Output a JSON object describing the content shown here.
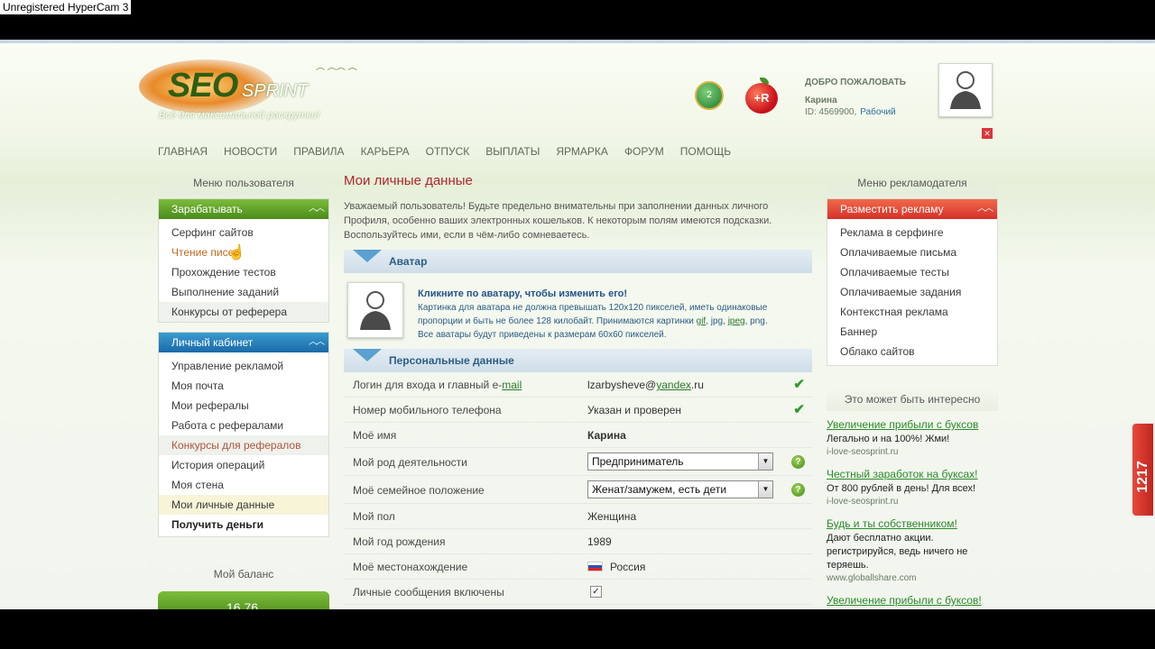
{
  "watermark": "Unregistered HyperCam 3",
  "logo": {
    "seo": "SEO",
    "sprint": "SPRINT",
    "tagline": "Всё для максимальной раскрутки!"
  },
  "header": {
    "medal_value": "2",
    "apple_label": "+R",
    "welcome": "ДОБРО ПОЖАЛОВАТЬ",
    "user_name": "Карина",
    "user_id": "ID: 4569900,",
    "user_status": "Рабочий"
  },
  "nav": [
    "ГЛАВНАЯ",
    "НОВОСТИ",
    "ПРАВИЛА",
    "КАРЬЕРА",
    "ОТПУСК",
    "ВЫПЛАТЫ",
    "ЯРМАРКА",
    "ФОРУМ",
    "ПОМОЩЬ"
  ],
  "left": {
    "title": "Меню пользователя",
    "earn": {
      "header": "Зарабатывать",
      "items": [
        "Серфинг сайтов",
        "Чтение писем",
        "Прохождение тестов",
        "Выполнение заданий",
        "Конкурсы от реферера"
      ]
    },
    "cabinet": {
      "header": "Личный кабинет",
      "items": [
        "Управление рекламой",
        "Моя почта",
        "Мои рефералы",
        "Работа с рефералами",
        "Конкурсы для рефералов",
        "История операций",
        "Моя стена",
        "Мои личные данные",
        "Получить деньги"
      ]
    },
    "balance_title": "Мой баланс",
    "balance_value": "16.76"
  },
  "main": {
    "title": "Мои личные данные",
    "intro": "Уважаемый пользователь! Будьте предельно внимательны при заполнении данных личного Профиля, особенно ваших электронных кошельков. К некоторым полям имеются подсказки. Воспользуйтесь ими, если в чём-либо сомневаетесь.",
    "avatar_section": "Аватар",
    "avatar_heading": "Кликните по аватару, чтобы изменить его!",
    "avatar_text_1": "Картинка для аватара не должна превышать 120х120 пикселей, иметь одинаковые пропорции и быть не более 128 килобайт. Принимаются картинки",
    "avatar_fmt_gif": "gif",
    "avatar_fmt_jpg": "jpg",
    "avatar_fmt_jpeg": "jpeg",
    "avatar_fmt_png": "png.",
    "avatar_text_2": "Все аватары будут приведены к размерам 60х60 пикселей.",
    "personal_section": "Персональные данные",
    "fields": {
      "login_label": "Логин для входа и главный e-",
      "login_label_link": "mail",
      "login_value_a": "lzarbysheve@",
      "login_value_link": "yandex",
      "login_value_b": ".ru",
      "phone_label": "Номер мобильного телефона",
      "phone_value": "Указан и проверен",
      "name_label": "Моё имя",
      "name_value": "Карина",
      "occupation_label": "Мой род деятельности",
      "occupation_value": "Предприниматель",
      "family_label": "Моё семейное положение",
      "family_value": "Женат/замужем, есть дети",
      "gender_label": "Мой пол",
      "gender_value": "Женщина",
      "birth_label": "Мой год рождения",
      "birth_value": "1989",
      "location_label": "Моё местонахождение",
      "location_value": "Россия",
      "messages_label": "Личные сообщения включены"
    }
  },
  "right": {
    "title": "Меню рекламодателя",
    "ads": {
      "header": "Разместить рекламу",
      "items": [
        "Реклама в серфинге",
        "Оплачиваемые письма",
        "Оплачиваемые тесты",
        "Оплачиваемые задания",
        "Контекстная реклама",
        "Баннер",
        "Облако сайтов"
      ]
    },
    "interest_title": "Это может быть интересно",
    "promos": [
      {
        "h": "Увеличение прибыли с буксов",
        "d": "Легально и на 100%! Жми!",
        "s": "i-love-seosprint.ru"
      },
      {
        "h": "Честный заработок на буксах!",
        "d": "От 800 рублей в день! Для всех!",
        "s": "i-love-seosprint.ru"
      },
      {
        "h": "Будь и ты собственником!",
        "d": "Дают бесплатно акции. регистрируйся, ведь ничего не теряешь.",
        "s": "www.globallshare.com"
      },
      {
        "h": "Увеличение прибыли с буксов!",
        "d": "",
        "s": ""
      }
    ]
  },
  "side_tab": "1217",
  "icons": {
    "check": "check-icon",
    "help": "help-icon",
    "close": "close-icon",
    "chevron": "chevron-up-icon",
    "cursor": "hand-cursor-icon"
  },
  "colors": {
    "accent_green": "#4a8a1a",
    "accent_red": "#d6302a",
    "accent_blue": "#1a6aa8",
    "title_red": "#b0262a"
  }
}
